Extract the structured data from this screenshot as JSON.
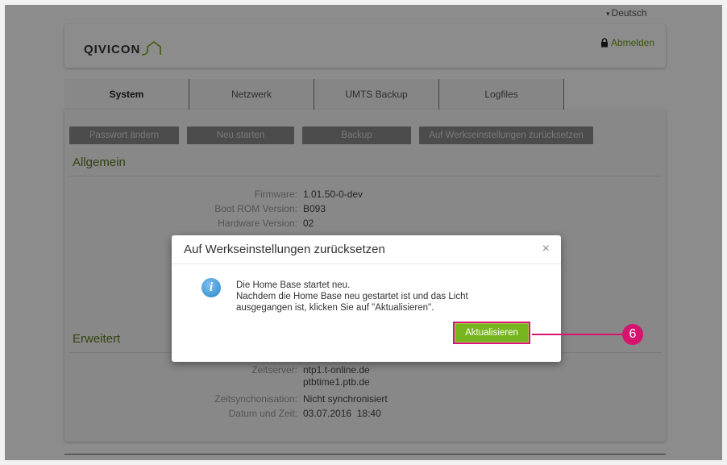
{
  "language": {
    "label": "Deutsch"
  },
  "header": {
    "logo_text": "QIVICON",
    "logout_label": "Abmelden"
  },
  "tabs": [
    {
      "label": "System",
      "active": true
    },
    {
      "label": "Netzwerk",
      "active": false
    },
    {
      "label": "UMTS Backup",
      "active": false
    },
    {
      "label": "Logfiles",
      "active": false
    }
  ],
  "actions": {
    "change_password": "Passwort ändern",
    "restart": "Neu starten",
    "backup": "Backup",
    "factory_reset": "Auf Werkseinstellungen zurücksetzen"
  },
  "general": {
    "title": "Allgemein",
    "rows": [
      {
        "key": "Firmware:",
        "value": "1.01.50-0-dev"
      },
      {
        "key": "Boot ROM Version:",
        "value": "B093"
      },
      {
        "key": "Hardware Version:",
        "value": "02"
      }
    ]
  },
  "advanced": {
    "title": "Erweitert",
    "rows": [
      {
        "key": "Zeitserver:",
        "value": "ntp1.t-online.de",
        "value2": "ptbtime1.ptb.de"
      },
      {
        "key": "Zeitsynchonisation:",
        "value": "Nicht synchronisiert"
      },
      {
        "key": "Datum und Zeit:",
        "value": "03.07.2016  18:40"
      }
    ]
  },
  "modal": {
    "title": "Auf Werkseinstellungen zurücksetzen",
    "close": "×",
    "message_line1": "Die Home Base startet neu.",
    "message_line2": "Nachdem die Home Base neu gestartet ist und das Licht",
    "message_line3": "ausgegangen ist, klicken Sie auf \"Aktualisieren\".",
    "button_label": "Aktualisieren"
  },
  "callout": {
    "number": "6"
  },
  "colors": {
    "accent_green": "#76b51d",
    "callout_magenta": "#d8136f"
  }
}
